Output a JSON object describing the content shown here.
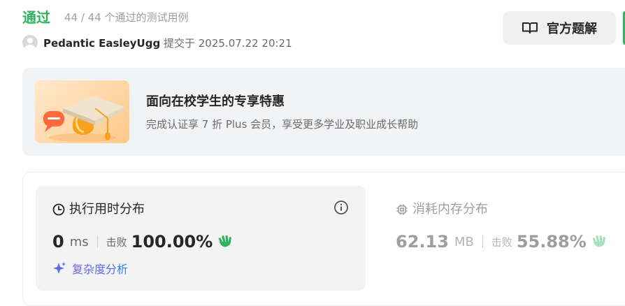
{
  "submission": {
    "status": "通过",
    "tests_summary": "44 / 44 个通过的测试用例",
    "username": "Pedantic EasleyUgg",
    "submitted_label": "提交于",
    "submitted_time": "2025.07.22 20:21"
  },
  "solution_button": {
    "label": "官方题解",
    "icon": "book-icon"
  },
  "promo": {
    "title": "面向在校学生的专享特惠",
    "description": "完成认证享 7 折 Plus 会员，享受更多学业及职业成长帮助",
    "image": "graduation-cap-illustration"
  },
  "runtime": {
    "title": "执行用时分布",
    "value": "0",
    "unit": "ms",
    "beats_label": "击败",
    "beats_value": "100.00%",
    "complexity_label": "复杂度分析"
  },
  "memory": {
    "title": "消耗内存分布",
    "value": "62.13",
    "unit": "MB",
    "beats_label": "击败",
    "beats_value": "55.88%"
  },
  "colors": {
    "accepted": "#2db55d",
    "wave_active": "#2db55d",
    "wave_inactive": "#a7e0bb",
    "complexity_gradient_start": "#7b5cf0",
    "complexity_gradient_end": "#2f7bf5"
  }
}
